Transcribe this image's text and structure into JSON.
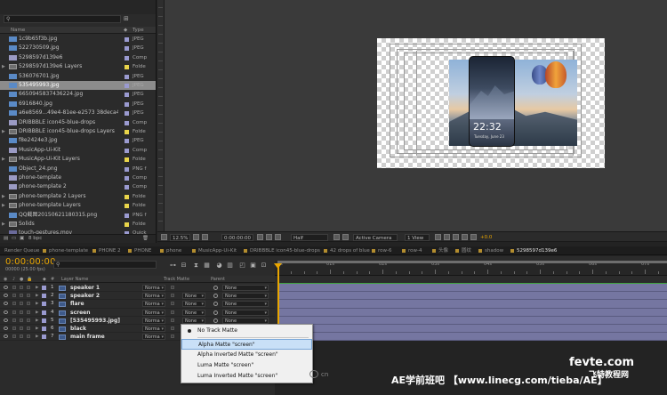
{
  "project": {
    "search_placeholder": "",
    "columns": {
      "name": "Name",
      "type": "Type"
    },
    "items": [
      {
        "name": "1c9b65f3b.jpg",
        "type": "JPEG",
        "icon": "image-icon",
        "folder": false,
        "color": "#9a9ad0"
      },
      {
        "name": "522730509.jpg",
        "type": "JPEG",
        "icon": "image-icon",
        "folder": false,
        "color": "#9a9ad0"
      },
      {
        "name": "5298597d139e6",
        "type": "Comp",
        "icon": "comp-icon",
        "folder": false,
        "color": "#9a9ad0"
      },
      {
        "name": "5298597d139e6 Layers",
        "type": "Folde",
        "icon": "folder-icon",
        "folder": true,
        "color": "#e8d44a"
      },
      {
        "name": "536076701.jpg",
        "type": "JPEG",
        "icon": "image-icon",
        "folder": false,
        "color": "#9a9ad0"
      },
      {
        "name": "535495993.jpg",
        "type": "JPEG",
        "icon": "image-icon",
        "folder": false,
        "color": "#9a9ad0",
        "selected": true
      },
      {
        "name": "6650945837436224.jpg",
        "type": "JPEG",
        "icon": "image-icon",
        "folder": false,
        "color": "#9a9ad0"
      },
      {
        "name": "6916840.jpg",
        "type": "JPEG",
        "icon": "image-icon",
        "folder": false,
        "color": "#9a9ad0"
      },
      {
        "name": "a6e8569...49e4-81ee-e2573 38deca4.jpg",
        "type": "JPEG",
        "icon": "image-icon",
        "folder": false,
        "color": "#9a9ad0"
      },
      {
        "name": "DRIBBBLE icon45-blue-drops",
        "type": "Comp",
        "icon": "comp-icon",
        "folder": false,
        "color": "#9a9ad0"
      },
      {
        "name": "DRIBBBLE icon45-blue-drops Layers",
        "type": "Folde",
        "icon": "folder-icon",
        "folder": true,
        "color": "#e8d44a"
      },
      {
        "name": "f8e2424e3.jpg",
        "type": "JPEG",
        "icon": "image-icon",
        "folder": false,
        "color": "#9a9ad0"
      },
      {
        "name": "MusicApp-Ui-Kit",
        "type": "Comp",
        "icon": "comp-icon",
        "folder": false,
        "color": "#9a9ad0"
      },
      {
        "name": "MusicApp-Ui-Kit Layers",
        "type": "Folde",
        "icon": "folder-icon",
        "folder": true,
        "color": "#e8d44a"
      },
      {
        "name": "Object_24.png",
        "type": "PNG f",
        "icon": "image-icon",
        "folder": false,
        "color": "#9a9ad0"
      },
      {
        "name": "phone-template",
        "type": "Comp",
        "icon": "comp-icon",
        "folder": false,
        "color": "#9a9ad0"
      },
      {
        "name": "phone-template 2",
        "type": "Comp",
        "icon": "comp-icon",
        "folder": false,
        "color": "#9a9ad0"
      },
      {
        "name": "phone-template 2 Layers",
        "type": "Folde",
        "icon": "folder-icon",
        "folder": true,
        "color": "#e8d44a"
      },
      {
        "name": "phone-template Layers",
        "type": "Folde",
        "icon": "folder-icon",
        "folder": true,
        "color": "#e8d44a"
      },
      {
        "name": "QQ截图20150621180315.png",
        "type": "PNG f",
        "icon": "image-icon",
        "folder": false,
        "color": "#9a9ad0"
      },
      {
        "name": "Solids",
        "type": "Folde",
        "icon": "folder-icon",
        "folder": true,
        "color": "#e8d44a"
      },
      {
        "name": "touch-gestures.mov",
        "type": "Quick",
        "icon": "video-icon",
        "folder": false,
        "color": "#9a9ad0"
      }
    ],
    "footer_bpc": "8 bpc"
  },
  "viewer_toolbar": {
    "zoom": "12.5%",
    "timecode": "0:00:00:00",
    "resolution": "Half",
    "camera": "Active Camera",
    "views": "1 View",
    "exposure": "+0.0"
  },
  "tabs": [
    {
      "label": "Render Queue",
      "active": false
    },
    {
      "label": "phone-template",
      "active": false
    },
    {
      "label": "PHONE 2",
      "active": false
    },
    {
      "label": "PHONE",
      "active": false
    },
    {
      "label": "phone",
      "active": false
    },
    {
      "label": "MusicApp-Ui-Kit",
      "active": false
    },
    {
      "label": "DRIBBBLE icon45-blue-drops",
      "active": false
    },
    {
      "label": "42 drops of blue",
      "active": false
    },
    {
      "label": "row-6",
      "active": false
    },
    {
      "label": "row-4",
      "active": false
    },
    {
      "label": "头像",
      "active": false
    },
    {
      "label": "圆纹",
      "active": false
    },
    {
      "label": "shadow",
      "active": false
    },
    {
      "label": "5298597d139e6",
      "active": true
    }
  ],
  "timeline": {
    "current_time": "0:00:00:00",
    "fps": "00000 (25.00 fps)",
    "columns": {
      "layer_name": "Layer Name",
      "track_matte": "Track Matte",
      "parent": "Parent"
    },
    "ruler_labels": [
      "0s",
      "01s",
      "02s",
      "03s",
      "04s",
      "05s",
      "06s",
      "07s"
    ],
    "layers": [
      {
        "num": "1",
        "name": "speaker 1",
        "mode": "Norma",
        "trkmat": "",
        "parent": "None",
        "color": "#9a9ad0"
      },
      {
        "num": "2",
        "name": "speaker 2",
        "mode": "Norma",
        "trkmat": "None",
        "parent": "None",
        "color": "#9a9ad0"
      },
      {
        "num": "3",
        "name": "flare",
        "mode": "Norma",
        "trkmat": "None",
        "parent": "None",
        "color": "#9a9ad0"
      },
      {
        "num": "4",
        "name": "screen",
        "mode": "Norma",
        "trkmat": "None",
        "parent": "None",
        "color": "#9a9ad0"
      },
      {
        "num": "5",
        "name": "[535495993.jpg]",
        "mode": "Norma",
        "trkmat": "None",
        "parent": "None",
        "color": "#9a9ad0"
      },
      {
        "num": "6",
        "name": "black",
        "mode": "Norma",
        "trkmat": "",
        "parent": "",
        "color": "#9a9ad0"
      },
      {
        "num": "7",
        "name": "main frame",
        "mode": "Norma",
        "trkmat": "",
        "parent": "",
        "color": "#9a9ad0"
      }
    ]
  },
  "context_menu": {
    "items": [
      {
        "label": "No Track Matte",
        "checked": true
      },
      {
        "label": "Alpha Matte \"screen\"",
        "hover": true
      },
      {
        "label": "Alpha Inverted Matte \"screen\""
      },
      {
        "label": "Luma Matte \"screen\""
      },
      {
        "label": "Luma Inverted Matte \"screen\""
      }
    ]
  },
  "viewer": {
    "phone_time": "22:32",
    "phone_date": "Tuesday, June 23"
  },
  "watermarks": {
    "main": "AE学前班吧 【www.linecg.com/tieba/AE】",
    "logo": "fevte.com",
    "logo2": "飞特教程网",
    "cn": "cn"
  },
  "colors": {
    "accent_time": "#e8a500",
    "layer_bar": "#7576a1",
    "selection": "#8c8c8c"
  }
}
